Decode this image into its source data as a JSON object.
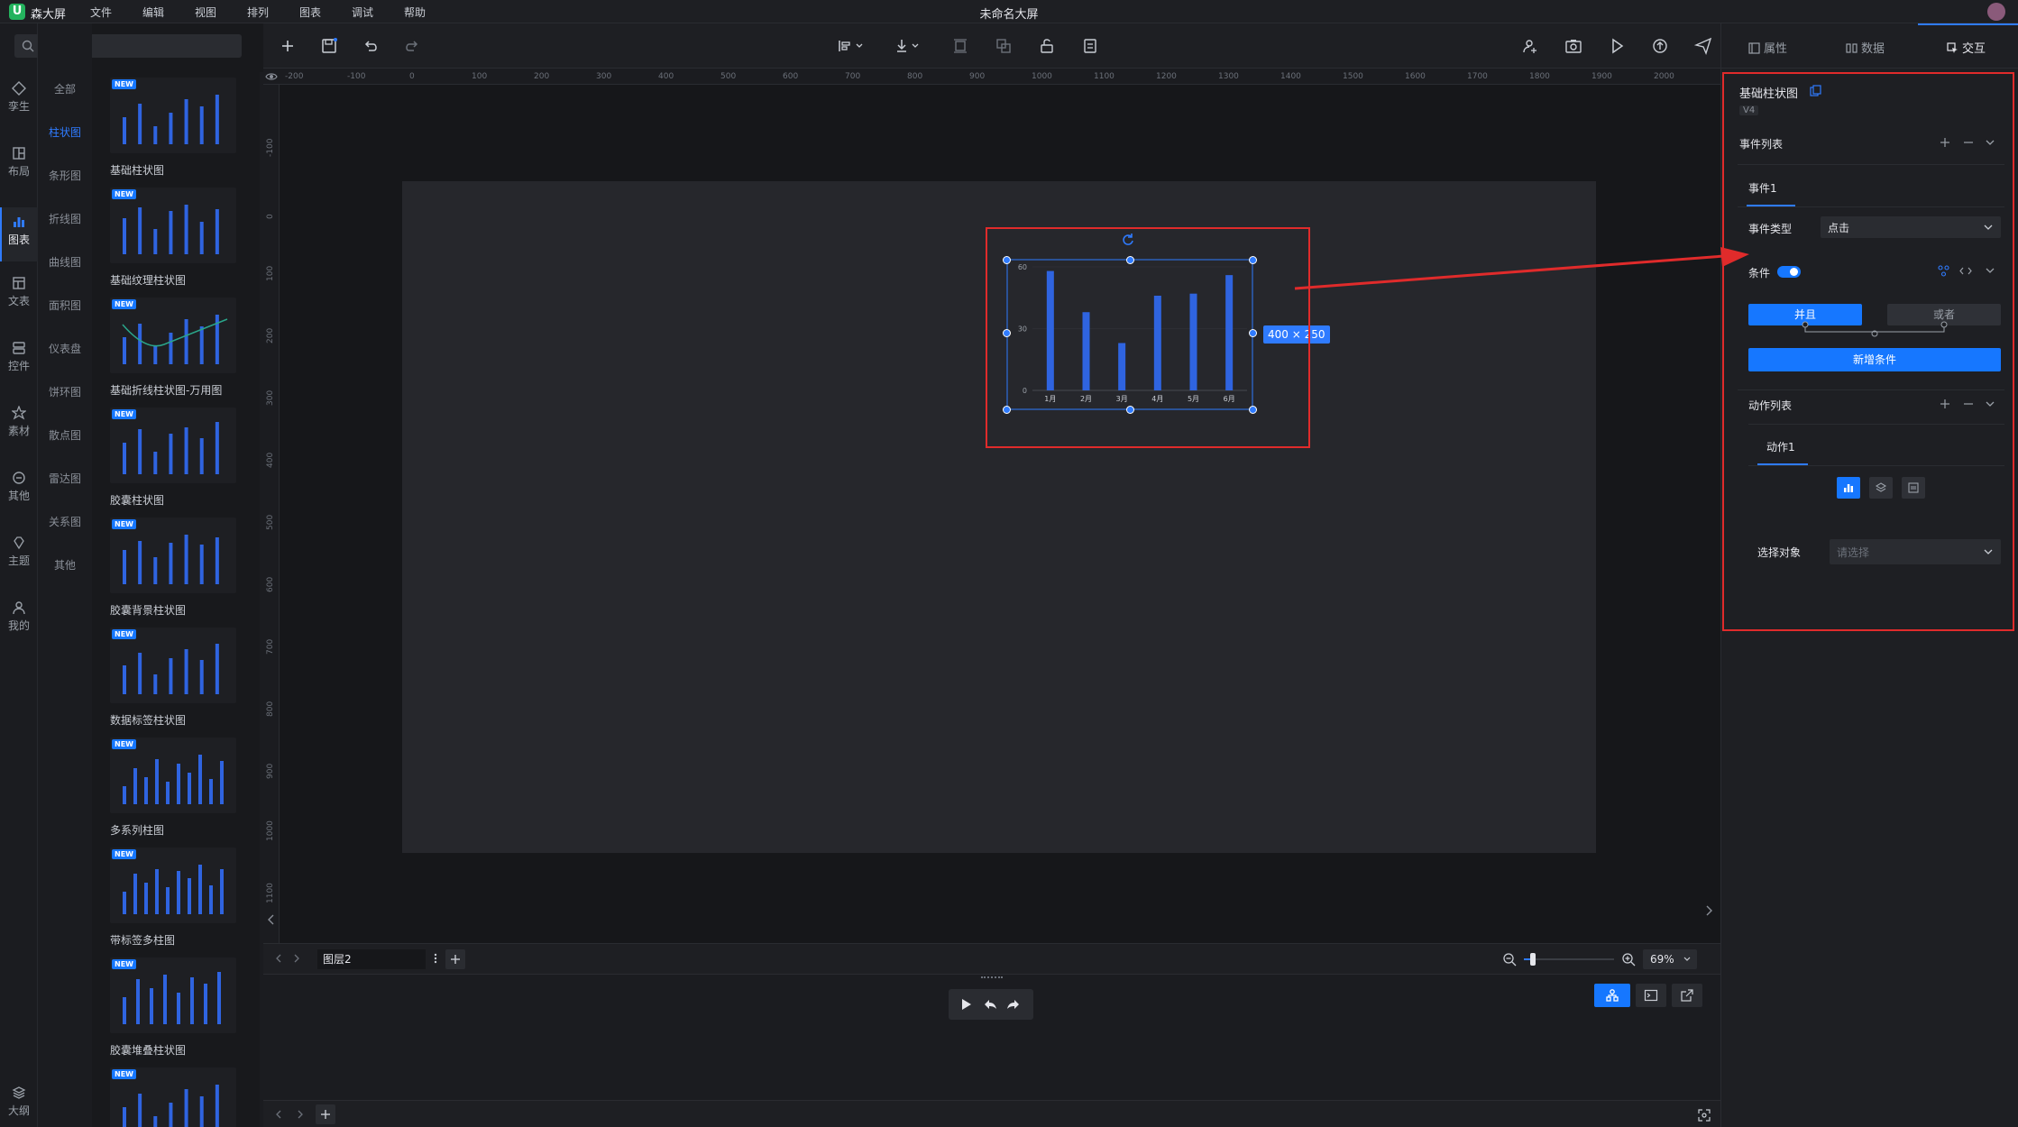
{
  "app": {
    "name": "森大屏",
    "doc_title": "未命名大屏"
  },
  "menu": [
    "文件",
    "编辑",
    "视图",
    "排列",
    "图表",
    "调试",
    "帮助"
  ],
  "search": {
    "placeholder": "搜索"
  },
  "rail": [
    "孪生",
    "布局",
    "图表",
    "文表",
    "控件",
    "素材",
    "其他",
    "主题",
    "我的",
    "大纲"
  ],
  "rail_active": "图表",
  "categories": [
    "全部",
    "柱状图",
    "条形图",
    "折线图",
    "曲线图",
    "面积图",
    "仪表盘",
    "饼环图",
    "散点图",
    "雷达图",
    "关系图",
    "其他"
  ],
  "category_active": "柱状图",
  "components": [
    {
      "label": "基础柱状图",
      "badge": "NEW"
    },
    {
      "label": "基础纹理柱状图",
      "badge": "NEW"
    },
    {
      "label": "基础折线柱状图-万用图",
      "badge": "NEW"
    },
    {
      "label": "胶囊柱状图",
      "badge": "NEW"
    },
    {
      "label": "胶囊背景柱状图",
      "badge": "NEW"
    },
    {
      "label": "数据标签柱状图",
      "badge": "NEW"
    },
    {
      "label": "多系列柱图",
      "badge": "NEW"
    },
    {
      "label": "带标签多柱图",
      "badge": "NEW"
    },
    {
      "label": "胶囊堆叠柱状图",
      "badge": "NEW"
    },
    {
      "label": "",
      "badge": "NEW"
    }
  ],
  "ruler_top": [
    "-200",
    "-100",
    "0",
    "100",
    "200",
    "300",
    "400",
    "500",
    "600",
    "700",
    "800",
    "900",
    "1000",
    "1100",
    "1200",
    "1300",
    "1400",
    "1500",
    "1600",
    "1700",
    "1800",
    "1900",
    "2000"
  ],
  "ruler_left": [
    "-100",
    "0",
    "100",
    "200",
    "300",
    "400",
    "500",
    "600",
    "700",
    "800",
    "900",
    "1000",
    "1100"
  ],
  "selected": {
    "size_label": "400 × 250"
  },
  "chart_data": {
    "type": "bar",
    "categories": [
      "1月",
      "2月",
      "3月",
      "4月",
      "5月",
      "6月"
    ],
    "values": [
      58,
      38,
      23,
      46,
      47,
      56
    ],
    "yticks": [
      "0",
      "30",
      "60"
    ],
    "ylim": [
      0,
      60
    ],
    "color": "#2f64e0"
  },
  "layer": {
    "name": "图层2"
  },
  "zoom": {
    "value": "69%",
    "level": 0.1
  },
  "panel": {
    "tabs": [
      "属性",
      "数据",
      "交互"
    ],
    "active_tab": "交互",
    "component_name": "基础柱状图",
    "version": "V4",
    "event_list_label": "事件列表",
    "event_tab": "事件1",
    "event_type_label": "事件类型",
    "event_type_value": "点击",
    "condition_label": "条件",
    "and_label": "并且",
    "or_label": "或者",
    "add_condition": "新增条件",
    "action_list_label": "动作列表",
    "action_tab": "动作1",
    "select_target_label": "选择对象",
    "select_target_placeholder": "请选择"
  },
  "colors": {
    "accent": "#1677ff",
    "annotation": "#e02b2b",
    "bar": "#2f64e0"
  }
}
